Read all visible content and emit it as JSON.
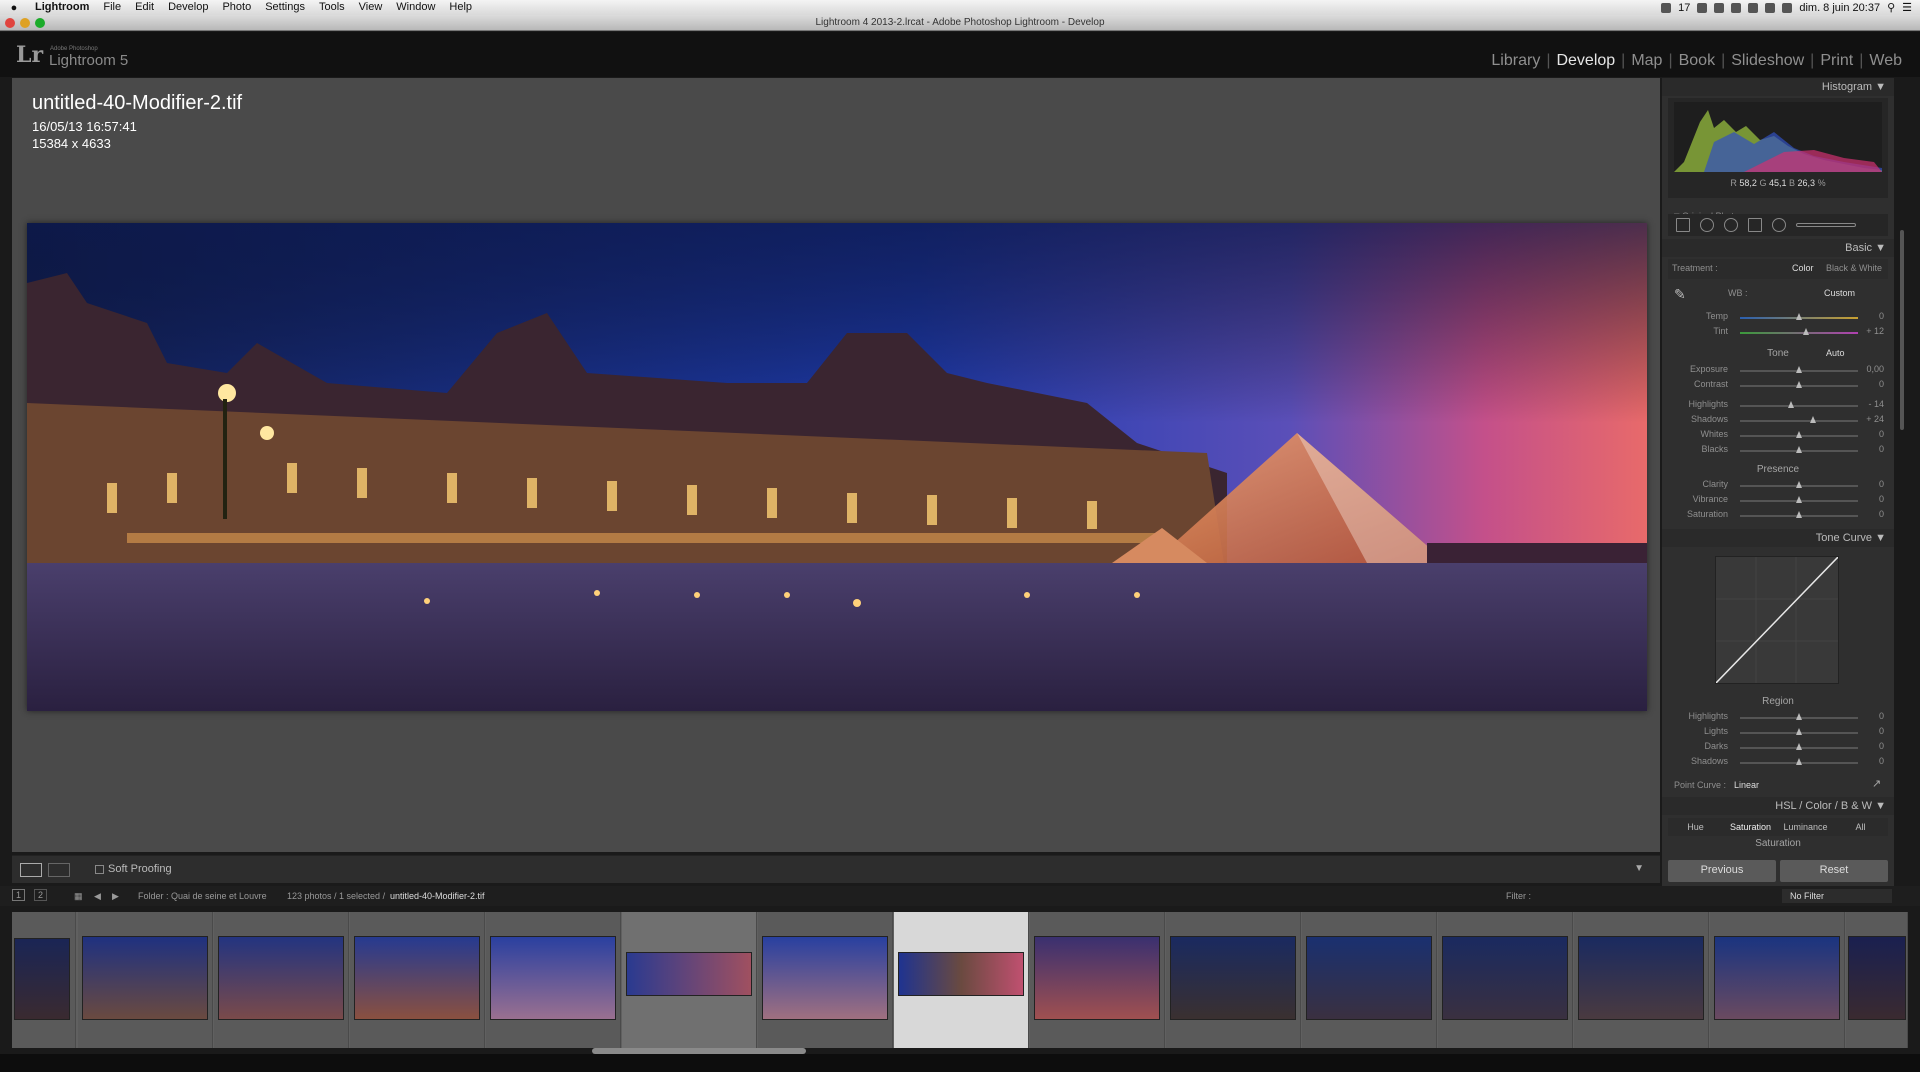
{
  "menubar": {
    "apple": "",
    "items": [
      "Lightroom",
      "File",
      "Edit",
      "Develop",
      "Photo",
      "Settings",
      "Tools",
      "View",
      "Window",
      "Help"
    ],
    "clock": "dim. 8 juin  20:37",
    "tray_badge": "17"
  },
  "window": {
    "title": "Lightroom 4 2013-2.lrcat - Adobe Photoshop Lightroom - Develop"
  },
  "app": {
    "logo": "Lr",
    "sub": "Adobe Photoshop",
    "name": "Lightroom 5",
    "modules": [
      "Library",
      "Develop",
      "Map",
      "Book",
      "Slideshow",
      "Print",
      "Web"
    ],
    "active_module": "Develop"
  },
  "photo_info": {
    "filename": "untitled-40-Modifier-2.tif",
    "datetime": "16/05/13 16:57:41",
    "dimensions": "15384 x 4633"
  },
  "toolbar": {
    "soft_proofing": "Soft Proofing"
  },
  "histogram": {
    "header": "Histogram",
    "r_label": "R",
    "r": "58,2",
    "g_label": "G",
    "g": "45,1",
    "b_label": "B",
    "b": "26,3",
    "unit": "%",
    "original_photo": "Original Photo"
  },
  "basic": {
    "header": "Basic",
    "treatment_label": "Treatment :",
    "treatment_color": "Color",
    "treatment_bw": "Black & White",
    "wb_label": "WB :",
    "wb_value": "Custom",
    "tone_label": "Tone",
    "auto": "Auto",
    "presence_label": "Presence",
    "sliders": [
      {
        "label": "Temp",
        "value": "0",
        "pos": 0.5
      },
      {
        "label": "Tint",
        "value": "+ 12",
        "pos": 0.56
      },
      {
        "label": "Exposure",
        "value": "0,00",
        "pos": 0.5
      },
      {
        "label": "Contrast",
        "value": "0",
        "pos": 0.5
      },
      {
        "label": "Highlights",
        "value": "- 14",
        "pos": 0.43
      },
      {
        "label": "Shadows",
        "value": "+ 24",
        "pos": 0.62
      },
      {
        "label": "Whites",
        "value": "0",
        "pos": 0.5
      },
      {
        "label": "Blacks",
        "value": "0",
        "pos": 0.5
      },
      {
        "label": "Clarity",
        "value": "0",
        "pos": 0.5
      },
      {
        "label": "Vibrance",
        "value": "0",
        "pos": 0.5
      },
      {
        "label": "Saturation",
        "value": "0",
        "pos": 0.5
      }
    ]
  },
  "tone_curve": {
    "header": "Tone Curve",
    "region_label": "Region",
    "sliders": [
      {
        "label": "Highlights",
        "value": "0",
        "pos": 0.5
      },
      {
        "label": "Lights",
        "value": "0",
        "pos": 0.5
      },
      {
        "label": "Darks",
        "value": "0",
        "pos": 0.5
      },
      {
        "label": "Shadows",
        "value": "0",
        "pos": 0.5
      }
    ],
    "point_curve_label": "Point Curve :",
    "point_curve_value": "Linear"
  },
  "hsl": {
    "header": "HSL  /  Color  /  B & W",
    "tabs": [
      "Hue",
      "Saturation",
      "Luminance",
      "All"
    ],
    "active_tab": "Saturation",
    "sub_label": "Saturation"
  },
  "buttons": {
    "previous": "Previous",
    "reset": "Reset"
  },
  "filmstrip_bar": {
    "page1": "1",
    "page2": "2",
    "folder": "Folder : Quai de seine et Louvre",
    "count": "123 photos / 1 selected /",
    "selected_file": "untitled-40-Modifier-2.tif",
    "filter_label": "Filter :",
    "filter_value": "No Filter"
  },
  "colors": {
    "accent_text": "#e6e6e6",
    "panel_bg": "#2f2f2f",
    "view_bg": "#4a4a4a"
  }
}
